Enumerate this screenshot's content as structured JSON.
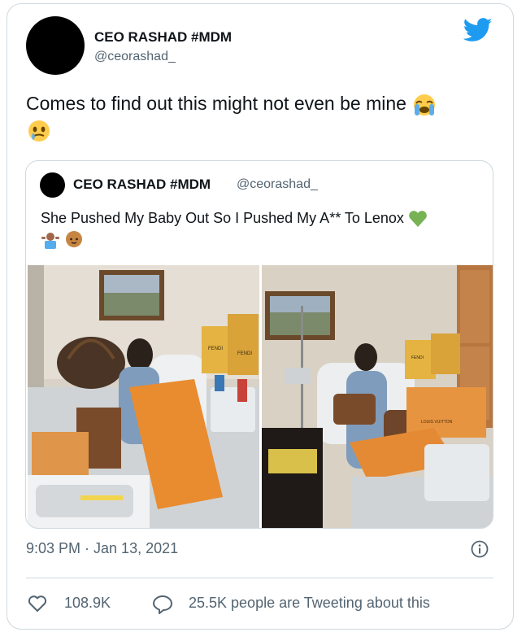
{
  "tweet": {
    "author_name": "CEO RASHAD #MDM",
    "author_handle": "@ceorashad_",
    "text": "Comes to find out this might not even be mine",
    "emojis": [
      "loudly-crying-face",
      "face-holding-back-tears"
    ]
  },
  "quoted_tweet": {
    "author_name": "CEO RASHAD #MDM",
    "author_handle": "@ceorashad_",
    "text": "She Pushed My Baby Out So I Pushed My A** To Lenox",
    "emojis": [
      "green-heart",
      "person-shrugging",
      "baby"
    ],
    "photo_box_labels": [
      "FENDI",
      "FENDI",
      "FENDI",
      "LOUIS VUITTON"
    ]
  },
  "footer": {
    "timestamp": "9:03 PM · Jan 13, 2021",
    "likes": "108.9K",
    "retweets": "25.5K people are Tweeting about this"
  },
  "colors": {
    "twitter_blue": "#1d9bf0",
    "secondary_text": "#536471",
    "border": "#cfd9de"
  }
}
